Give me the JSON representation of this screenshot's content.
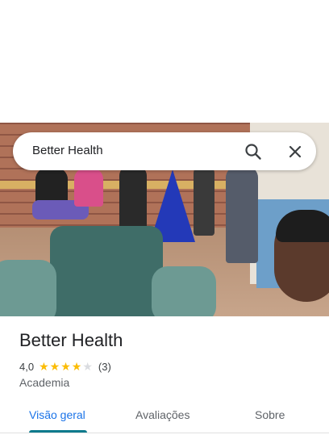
{
  "search": {
    "query": "Better Health"
  },
  "icons": {
    "search": "search-icon",
    "close": "close-icon"
  },
  "place": {
    "name": "Better Health",
    "rating": "4,0",
    "stars_filled": 4,
    "stars_total": 5,
    "review_count": "(3)",
    "category": "Academia"
  },
  "tabs": [
    {
      "label": "Visão geral",
      "active": true
    },
    {
      "label": "Avaliações",
      "active": false
    },
    {
      "label": "Sobre",
      "active": false
    }
  ],
  "colors": {
    "star_filled": "#fbbc04",
    "star_empty": "#dadce0",
    "active_tab": "#1a73e8",
    "tab_underline": "#0b7a8c"
  }
}
